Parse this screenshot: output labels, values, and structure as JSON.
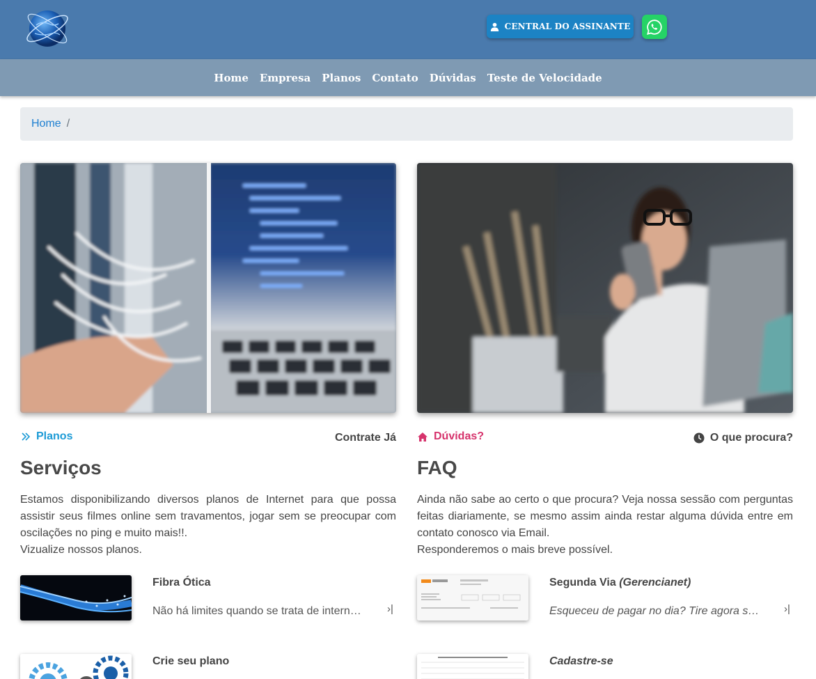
{
  "header": {
    "assinante_label": "CENTRAL DO ASSINANTE"
  },
  "nav": {
    "items": [
      "Home",
      "Empresa",
      "Planos",
      "Contato",
      "Dúvidas",
      "Teste de Velocidade"
    ]
  },
  "breadcrumb": {
    "home": "Home",
    "separator": "/"
  },
  "servicos": {
    "link_label": "Planos",
    "cta_label": "Contrate Já",
    "title": "Serviços",
    "text_main": "Estamos disponibilizando diversos planos de Internet para que possa assistir seus filmes online sem travamentos, jogar sem se preocupar com oscilações no ping e muito mais!!.",
    "text_extra": "Vizualize nossos planos.",
    "items": [
      {
        "title": "Fibra Ótica",
        "desc": "Não há limites quando se trata de internet de fibra ótica"
      },
      {
        "title": "Crie seu plano"
      }
    ]
  },
  "faq": {
    "link_label": "Dúvidas?",
    "cta_label": "O que procura?",
    "title": "FAQ",
    "text_main": "Ainda não sabe ao certo o que procura? Veja nossa sessão com perguntas feitas diariamente, se mesmo assim ainda restar alguma dúvida entre em contato conosco via Email.",
    "text_extra": "Responderemos o mais breve possível.",
    "items": [
      {
        "title": "Segunda Via",
        "title_em": "(Gerencianet)",
        "desc": "Esqueceu de pagar no dia? Tire agora sua segunda via"
      },
      {
        "title": "Cadastre-se"
      }
    ]
  },
  "colors": {
    "topbar": "#4a7aad",
    "navbar": "#7f9ab3",
    "button": "#1c83c4",
    "whatsapp": "#25d366",
    "link_blue": "#1d9bd6",
    "link_pink": "#d6336c"
  }
}
